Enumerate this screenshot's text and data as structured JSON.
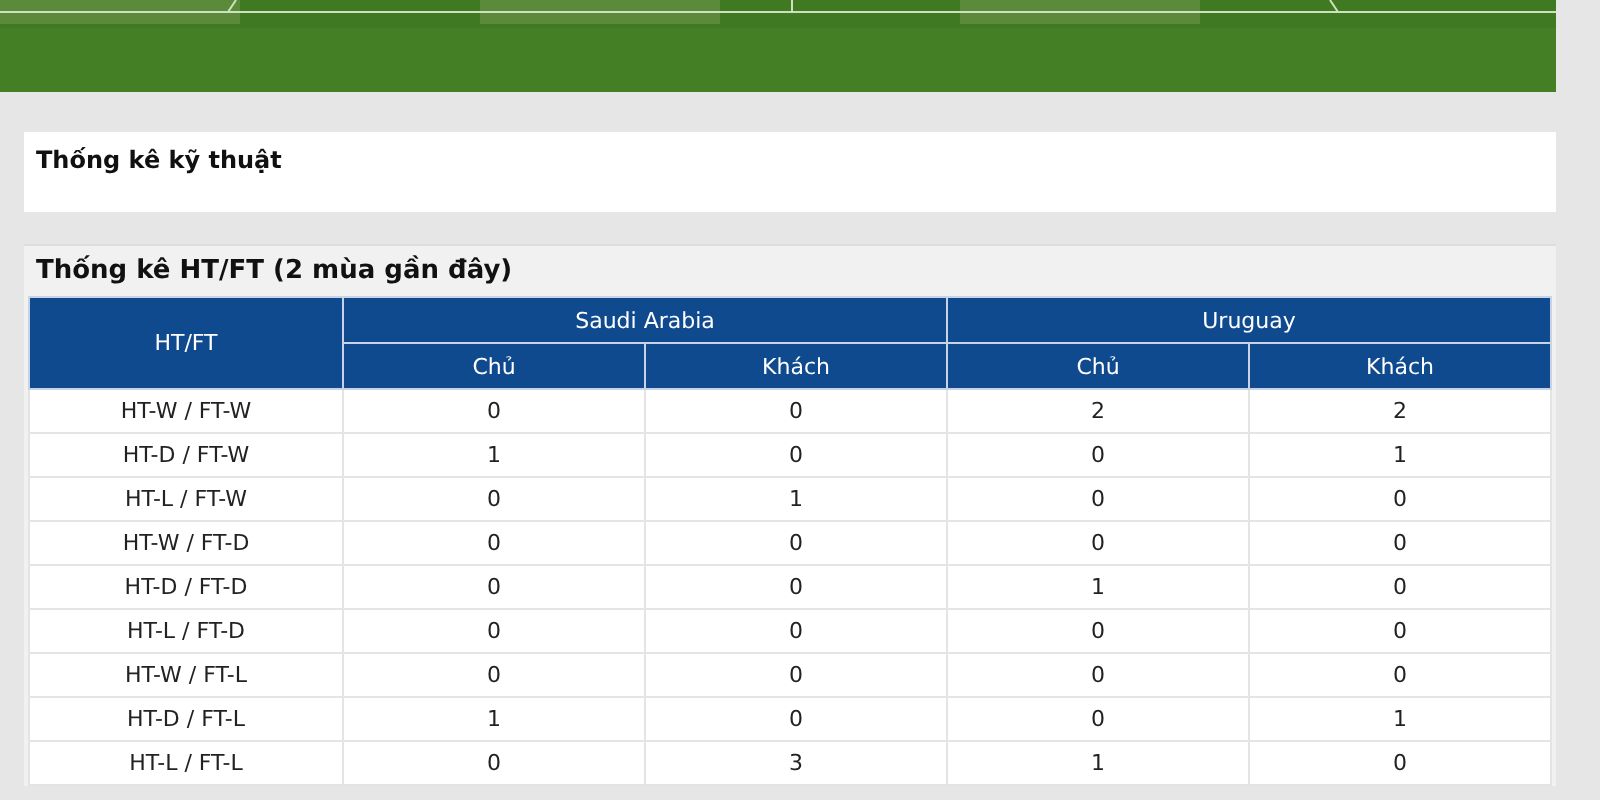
{
  "tech_section": {
    "title": "Thống kê kỹ thuật"
  },
  "htft_section": {
    "title": "Thống kê HT/FT (2 mùa gần đây)",
    "table": {
      "row_header": "HT/FT",
      "teams": [
        {
          "name": "Saudi Arabia",
          "columns": [
            "Chủ",
            "Khách"
          ]
        },
        {
          "name": "Uruguay",
          "columns": [
            "Chủ",
            "Khách"
          ]
        }
      ],
      "rows": [
        {
          "label": "HT-W / FT-W",
          "values": [
            "0",
            "0",
            "2",
            "2"
          ]
        },
        {
          "label": "HT-D / FT-W",
          "values": [
            "1",
            "0",
            "0",
            "1"
          ]
        },
        {
          "label": "HT-L / FT-W",
          "values": [
            "0",
            "1",
            "0",
            "0"
          ]
        },
        {
          "label": "HT-W / FT-D",
          "values": [
            "0",
            "0",
            "0",
            "0"
          ]
        },
        {
          "label": "HT-D / FT-D",
          "values": [
            "0",
            "0",
            "1",
            "0"
          ]
        },
        {
          "label": "HT-L / FT-D",
          "values": [
            "0",
            "0",
            "0",
            "0"
          ]
        },
        {
          "label": "HT-W / FT-L",
          "values": [
            "0",
            "0",
            "0",
            "0"
          ]
        },
        {
          "label": "HT-D / FT-L",
          "values": [
            "1",
            "0",
            "0",
            "1"
          ]
        },
        {
          "label": "HT-L / FT-L",
          "values": [
            "0",
            "3",
            "1",
            "0"
          ]
        }
      ]
    }
  }
}
